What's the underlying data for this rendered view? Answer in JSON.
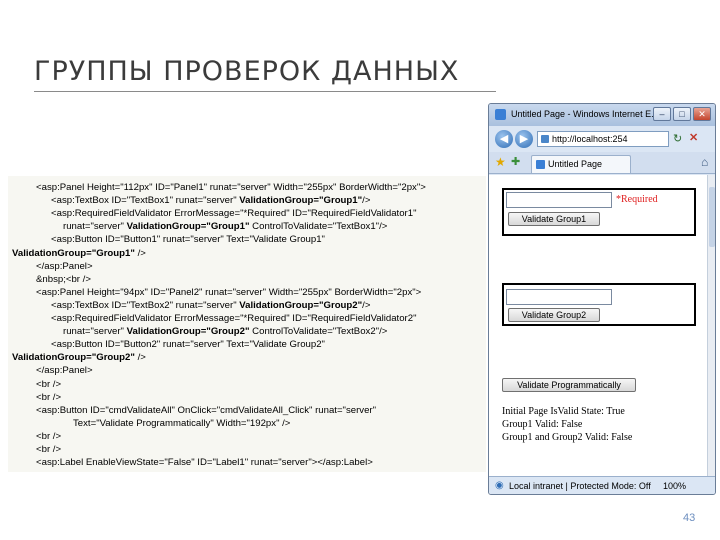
{
  "slide": {
    "title": "ГРУППЫ ПРОВЕРОК ДАННЫХ",
    "page_number": "43"
  },
  "code": {
    "lines": [
      [
        {
          "t": "<asp:Panel Height=\"112px\" ID=\"Panel1\" runat=\"server\" Width=\"255px\" BorderWidth=\"2px\">",
          "b": false
        }
      ],
      [
        {
          "t": "<asp:TextBox ID=\"TextBox1\" runat=\"server\" ",
          "b": false
        },
        {
          "t": "ValidationGroup=\"Group1\"",
          "b": true
        },
        {
          "t": "/>",
          "b": false
        }
      ],
      [
        {
          "t": "<asp:RequiredFieldValidator ErrorMessage=\"*Required\" ID=\"RequiredFieldValidator1\"",
          "b": false
        }
      ],
      [
        {
          "t": "runat=\"server\" ",
          "b": false
        },
        {
          "t": "ValidationGroup=\"Group1\"",
          "b": true
        },
        {
          "t": " ControlToValidate=\"TextBox1\"/>",
          "b": false
        }
      ],
      [
        {
          "t": "<asp:Button ID=\"Button1\" runat=\"server\" Text=\"Validate Group1\"",
          "b": false
        }
      ],
      [
        {
          "t": "ValidationGroup=\"Group1\"",
          "b": true
        },
        {
          "t": " />",
          "b": false
        }
      ],
      [
        {
          "t": "</asp:Panel>",
          "b": false
        }
      ],
      [
        {
          "t": "&nbsp;<br />",
          "b": false
        }
      ],
      [
        {
          "t": "<asp:Panel Height=\"94px\" ID=\"Panel2\" runat=\"server\" Width=\"255px\" BorderWidth=\"2px\">",
          "b": false
        }
      ],
      [
        {
          "t": "<asp:TextBox ID=\"TextBox2\" runat=\"server\" ",
          "b": false
        },
        {
          "t": "ValidationGroup=\"Group2\"",
          "b": true
        },
        {
          "t": "/>",
          "b": false
        }
      ],
      [
        {
          "t": "<asp:RequiredFieldValidator ErrorMessage=\"*Required\" ID=\"RequiredFieldValidator2\"",
          "b": false
        }
      ],
      [
        {
          "t": "runat=\"server\" ",
          "b": false
        },
        {
          "t": "ValidationGroup=\"Group2\"",
          "b": true
        },
        {
          "t": " ControlToValidate=\"TextBox2\"/>",
          "b": false
        }
      ],
      [
        {
          "t": "<asp:Button ID=\"Button2\" runat=\"server\" Text=\"Validate Group2\"",
          "b": false
        }
      ],
      [
        {
          "t": "ValidationGroup=\"Group2\"",
          "b": true
        },
        {
          "t": " />",
          "b": false
        }
      ],
      [
        {
          "t": "</asp:Panel>",
          "b": false
        }
      ],
      [
        {
          "t": "<br />",
          "b": false
        }
      ],
      [
        {
          "t": "<br />",
          "b": false
        }
      ],
      [
        {
          "t": "<asp:Button ID=\"cmdValidateAll\" OnClick=\"cmdValidateAll_Click\" runat=\"server\"",
          "b": false
        }
      ],
      [
        {
          "t": "Text=\"Validate Programmatically\" Width=\"192px\" />",
          "b": false
        }
      ],
      [
        {
          "t": "<br />",
          "b": false
        }
      ],
      [
        {
          "t": "<br />",
          "b": false
        }
      ],
      [
        {
          "t": "<asp:Label EnableViewState=\"False\" ID=\"Label1\" runat=\"server\"></asp:Label>",
          "b": false
        }
      ]
    ]
  },
  "browser": {
    "window_title": "Untitled Page - Windows Internet E...",
    "minimize": "–",
    "maximize": "□",
    "close": "✕",
    "back": "◀",
    "forward": "▶",
    "address": "http://localhost:254",
    "refresh": "↻",
    "stop": "✕",
    "favorites_icon": "star-icon",
    "add_favorite": "✚",
    "tab_label": "Untitled Page",
    "home": "⌂",
    "page": {
      "required_text": "*Required",
      "validate_group1": "Validate Group1",
      "validate_group2": "Validate Group2",
      "validate_all": "Validate Programmatically",
      "result_lines": [
        "Initial Page IsValid State: True",
        "Group1 Valid: False",
        "Group1 and Group2 Valid: False"
      ]
    },
    "status": {
      "zone": "Local intranet | Protected Mode: Off",
      "zoom": "100%"
    }
  }
}
